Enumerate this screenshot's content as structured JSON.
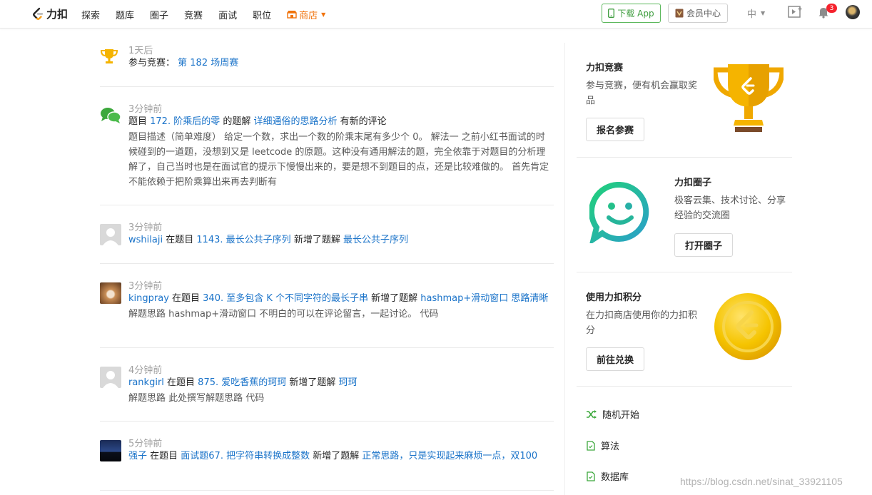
{
  "nav": {
    "logo_text": "力扣",
    "links": [
      "探索",
      "题库",
      "圈子",
      "竞赛",
      "面试",
      "职位"
    ],
    "shop_label": "商店",
    "download_label": "下载 App",
    "vip_label": "会员中心",
    "lang_label": "中",
    "notification_count": "3"
  },
  "feed": {
    "contest": {
      "time": "1天后",
      "prefix": "参与竞赛：",
      "link": "第 182 场周赛"
    },
    "comment": {
      "time": "3分钟前",
      "p1": "题目 ",
      "problem": "172. 阶乘后的零",
      "p2": " 的题解 ",
      "solution": "详细通俗的思路分析",
      "p3": " 有新的评论",
      "desc": "题目描述（简单难度） 给定一个数，求出一个数的阶乘末尾有多少个 0。 解法一 之前小红书面试的时候碰到的一道题，没想到又是 leetcode 的原题。这种没有通用解法的题，完全依靠于对题目的分析理解了，自己当时也是在面试官的提示下慢慢出来的，要是想不到题目的点，还是比较难做的。 首先肯定不能依赖于把阶乘算出来再去判断有"
    },
    "posts": [
      {
        "time": "3分钟前",
        "user": "wshilaji",
        "mid1": " 在题目 ",
        "problem": "1143. 最长公共子序列",
        "mid2": " 新增了题解 ",
        "solution": "最长公共子序列",
        "desc": ""
      },
      {
        "time": "3分钟前",
        "user": "kingpray",
        "mid1": " 在题目 ",
        "problem": "340. 至多包含 K 个不同字符的最长子串",
        "mid2": " 新增了题解 ",
        "solution": "hashmap+滑动窗口 思路清晰",
        "desc": "解题思路 hashmap+滑动窗口 不明白的可以在评论留言，一起讨论。 代码"
      },
      {
        "time": "4分钟前",
        "user": "rankgirl",
        "mid1": " 在题目 ",
        "problem": "875. 爱吃香蕉的珂珂",
        "mid2": " 新增了题解 ",
        "solution": "珂珂",
        "desc": "解题思路 此处撰写解题思路 代码"
      },
      {
        "time": "5分钟前",
        "user": "强子",
        "mid1": " 在题目 ",
        "problem": "面试题67. 把字符串转换成整数",
        "mid2": " 新增了题解 ",
        "solution": "正常思路，只是实现起来麻烦一点，双100",
        "desc": ""
      }
    ]
  },
  "sidebar": {
    "contest": {
      "title": "力扣竞赛",
      "text": "参与竞赛，便有机会赢取奖品",
      "button": "报名参赛"
    },
    "circle": {
      "title": "力扣圈子",
      "text": "极客云集、技术讨论、分享经验的交流圈",
      "button": "打开圈子"
    },
    "points": {
      "title": "使用力扣积分",
      "text": "在力扣商店使用你的力扣积分",
      "button": "前往兑换"
    },
    "quick_links": [
      "随机开始",
      "算法",
      "数据库"
    ]
  },
  "watermark": "https://blog.csdn.net/sinat_33921105",
  "colors": {
    "link": "#1a73c9",
    "shop": "#f0730c",
    "download_green": "#5cb85c",
    "badge_red": "#f5222d",
    "trophy_gold": "#f5b400",
    "chat_teal": "#2cc4a6"
  }
}
